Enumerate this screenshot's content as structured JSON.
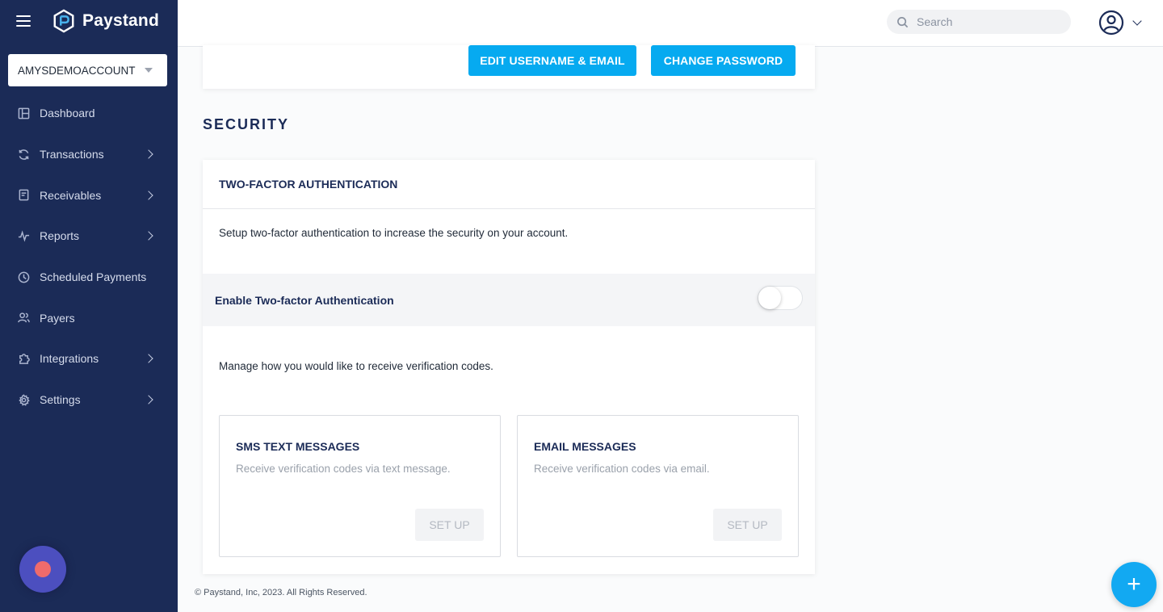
{
  "app": {
    "name": "Paystand"
  },
  "account": {
    "selected": "AMYSDEMOACCOUNT"
  },
  "sidebar": {
    "items": [
      {
        "label": "Dashboard",
        "icon": "dashboard-icon",
        "has_submenu": false
      },
      {
        "label": "Transactions",
        "icon": "refresh-icon",
        "has_submenu": true
      },
      {
        "label": "Receivables",
        "icon": "document-icon",
        "has_submenu": true
      },
      {
        "label": "Reports",
        "icon": "activity-icon",
        "has_submenu": true
      },
      {
        "label": "Scheduled Payments",
        "icon": "clock-icon",
        "has_submenu": false
      },
      {
        "label": "Payers",
        "icon": "users-icon",
        "has_submenu": false
      },
      {
        "label": "Integrations",
        "icon": "puzzle-icon",
        "has_submenu": true
      },
      {
        "label": "Settings",
        "icon": "gear-icon",
        "has_submenu": true
      }
    ]
  },
  "topbar": {
    "search_placeholder": "Search"
  },
  "profile_card": {
    "edit_label": "EDIT USERNAME & EMAIL",
    "password_label": "CHANGE PASSWORD"
  },
  "security": {
    "section_title": "SECURITY",
    "card_title": "TWO-FACTOR AUTHENTICATION",
    "description": "Setup two-factor authentication to increase the security on your account.",
    "toggle_label": "Enable Two-factor Authentication",
    "toggle_enabled": false,
    "manage_text": "Manage how you would like to receive verification codes.",
    "methods": [
      {
        "title": "SMS TEXT MESSAGES",
        "description": "Receive verification codes via text message.",
        "button": "SET UP"
      },
      {
        "title": "EMAIL MESSAGES",
        "description": "Receive verification codes via email.",
        "button": "SET UP"
      }
    ]
  },
  "footer": {
    "text": "© Paystand, Inc, 2023. All Rights Reserved."
  },
  "colors": {
    "sidebar": "#1b2b57",
    "accent": "#06aaf0",
    "record": "#ef6b6b"
  }
}
